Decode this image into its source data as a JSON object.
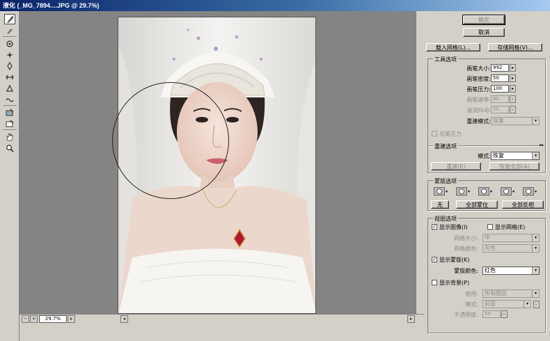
{
  "window": {
    "title": "液化 (_MG_7894....JPG @ 29.7%)"
  },
  "view": {
    "zoom": "29.7%"
  },
  "buttons": {
    "ok": "确定",
    "cancel": "取消",
    "load_mesh": "载入网格(L)...",
    "save_mesh": "存储网格(V)..."
  },
  "tool_options": {
    "title": "工具选项",
    "brush_size_label": "画笔大小:",
    "brush_size": "992",
    "brush_density_label": "画笔密度:",
    "brush_density": "50",
    "brush_pressure_label": "画笔压力:",
    "brush_pressure": "100",
    "brush_rate_label": "画笔速率:",
    "brush_rate": "80",
    "turbulent_jitter_label": "湍流抖动:",
    "turbulent_jitter": "50",
    "reconstruct_mode_label": "重建模式:",
    "reconstruct_mode": "恢复",
    "stylus_pressure_label": "光笔压力"
  },
  "reconstruct_options": {
    "title": "重建选项",
    "mode_label": "模式:",
    "mode": "恢复",
    "reconstruct_button": "重建(E)",
    "restore_all_button": "恢复全部(A)"
  },
  "mask_options": {
    "title": "蒙版选项",
    "none_button": "无",
    "mask_all_button": "全部蒙住",
    "invert_all_button": "全部反相"
  },
  "view_options": {
    "title": "视图选项",
    "show_image_label": "显示图像(I)",
    "show_mesh_label": "显示网格(E)",
    "mesh_size_label": "网格大小:",
    "mesh_size": "中",
    "mesh_color_label": "网格颜色:",
    "mesh_color": "灰色",
    "show_mask_label": "显示蒙版(K)",
    "mask_color_label": "蒙版颜色:",
    "mask_color": "红色",
    "show_backdrop_label": "显示背景(P)",
    "use_label": "使用:",
    "use_value": "所有图层",
    "mode_label": "模式:",
    "mode_value": "前面",
    "opacity_label": "不透明度:",
    "opacity_value": "50"
  },
  "colors": {
    "title_bar": "#0a246a",
    "canvas_bg": "#848484",
    "panel_bg": "#d4d0c8",
    "mask_red": "#cc2233"
  }
}
